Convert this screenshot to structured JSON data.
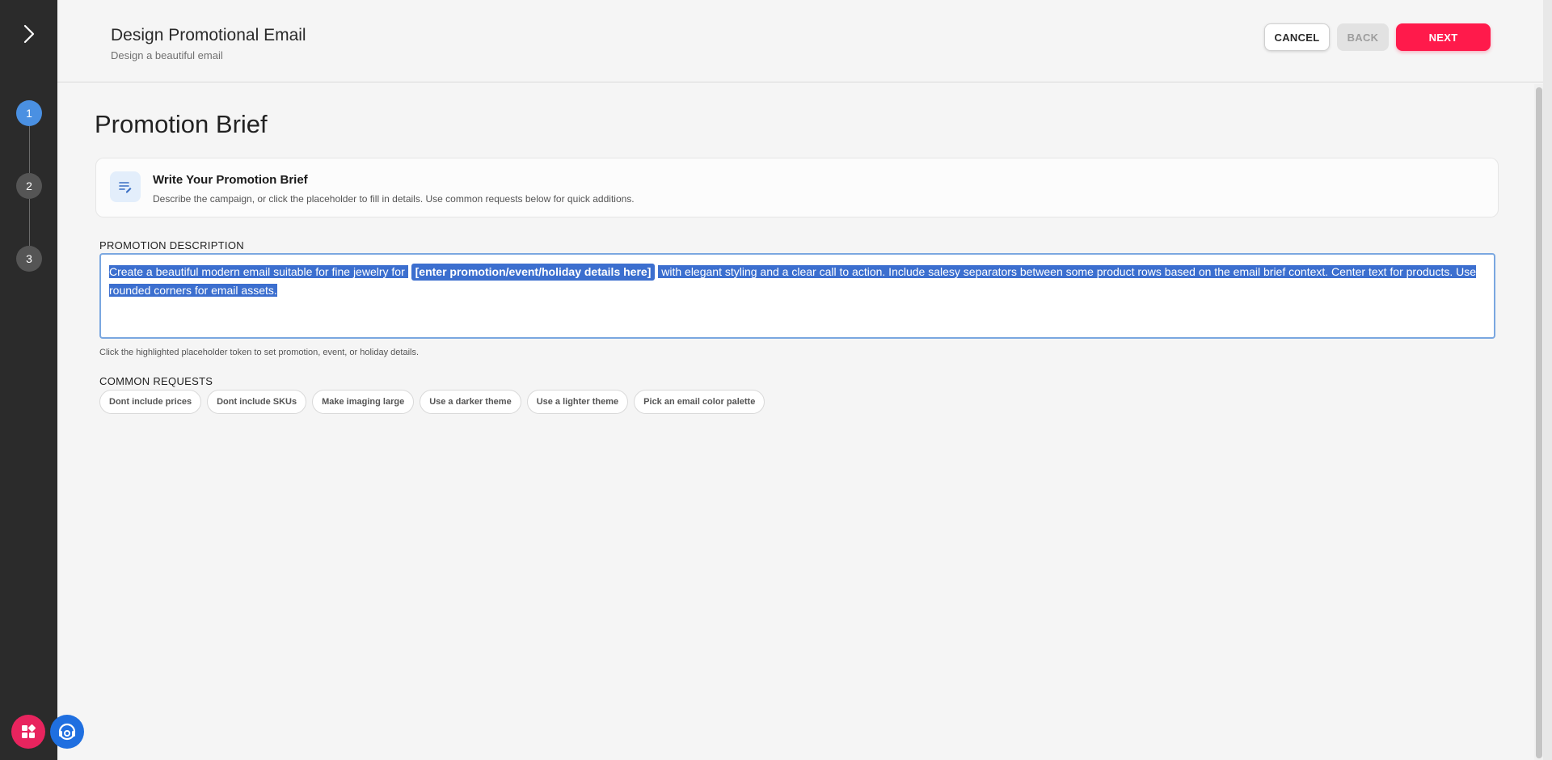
{
  "header": {
    "title": "Design Promotional Email",
    "subtitle": "Design a beautiful email",
    "cancel_label": "CANCEL",
    "back_label": "BACK",
    "next_label": "NEXT"
  },
  "stepper": {
    "steps": [
      {
        "label": "1",
        "active": true
      },
      {
        "label": "2",
        "active": false
      },
      {
        "label": "3",
        "active": false
      }
    ]
  },
  "main": {
    "page_title": "Promotion Brief",
    "card": {
      "icon": "edit-note-icon",
      "title": "Write Your Promotion Brief",
      "description": "Describe the campaign, or click the placeholder to fill in details. Use common requests below for quick additions."
    },
    "description_label": "PROMOTION DESCRIPTION",
    "description_text_before": "Create a beautiful modern email suitable for fine jewelry for",
    "description_placeholder_token": "[enter promotion/event/holiday details here]",
    "description_text_after": "with elegant styling and a clear call to action. Include salesy separators between some product rows based on the email brief context. Center text for products. Use rounded corners for email assets.",
    "hint": "Click the highlighted placeholder token to set promotion, event, or holiday details.",
    "common_requests_label": "COMMON REQUESTS",
    "common_requests": [
      "Dont include prices",
      "Dont include SKUs",
      "Make imaging large",
      "Use a darker theme",
      "Use a lighter theme",
      "Pick an email color palette"
    ]
  },
  "colors": {
    "accent_primary": "#ff1a4b",
    "step_active": "#4a90e2",
    "rail_bg": "#2b2b2b",
    "selection": "#3c6fcf"
  },
  "icons": {
    "rail_toggle": "chevron-right-icon",
    "apps_fab": "apps-icon",
    "help_fab": "support-icon"
  }
}
